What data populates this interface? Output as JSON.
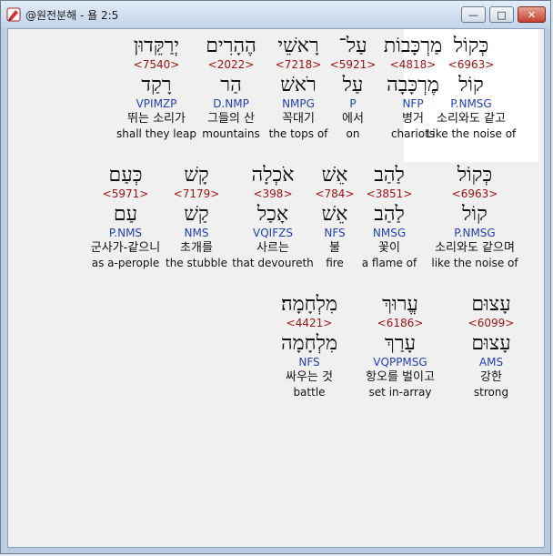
{
  "window": {
    "title": "@원전분해 - 욜 2:5",
    "controls": {
      "minimize": "—",
      "maximize": "□",
      "close": "✕"
    },
    "icon": "app-icon"
  },
  "rows": [
    {
      "words": [
        {
          "hebrew": "כְּקוֹל",
          "strongs": "<6963>",
          "lemma": "קוֹל",
          "morph": "P.NMSG",
          "korean": "소리와도 같고",
          "english": "Like the noise of",
          "selected": true
        },
        {
          "hebrew": "מַרְכָּבוֹת",
          "strongs": "<4818>",
          "lemma": "מֶרְכָּבָה",
          "morph": "NFP",
          "korean": "병거",
          "english": "chariots",
          "selected": false
        },
        {
          "hebrew": "עַל־",
          "strongs": "<5921>",
          "lemma": "עַל",
          "morph": "P",
          "korean": "에서",
          "english": "on",
          "selected": false
        },
        {
          "hebrew": "רָאשֵׁי",
          "strongs": "<7218>",
          "lemma": "רֹאשׁ",
          "morph": "NMPG",
          "korean": "꼭대기",
          "english": "the tops of",
          "selected": false
        },
        {
          "hebrew": "הֶהָרִים",
          "strongs": "<2022>",
          "lemma": "הַר",
          "morph": "D.NMP",
          "korean": "그들의 산",
          "english": "mountains",
          "selected": false
        },
        {
          "hebrew": "יְרַקֵּדוּן",
          "strongs": "<7540>",
          "lemma": "רָקַד",
          "morph": "VPIMZP",
          "korean": "뛰는 소리가",
          "english": "shall they leap",
          "selected": false
        }
      ]
    },
    {
      "words": [
        {
          "hebrew": "כְּקוֹל",
          "strongs": "<6963>",
          "lemma": "קוֹל",
          "morph": "P.NMSG",
          "korean": "소리와도 같으며",
          "english": "like the noise of",
          "selected": false
        },
        {
          "hebrew": "לַהַב",
          "strongs": "<3851>",
          "lemma": "לַהַב",
          "morph": "NMSG",
          "korean": "꽃이",
          "english": "a flame of",
          "selected": false
        },
        {
          "hebrew": "אֵשׁ",
          "strongs": "<784>",
          "lemma": "אֵשׁ",
          "morph": "NFS",
          "korean": "불",
          "english": "fire",
          "selected": false
        },
        {
          "hebrew": "אֹכְלָה",
          "strongs": "<398>",
          "lemma": "אָכַל",
          "morph": "VQIFZS",
          "korean": "사르는",
          "english": "that devoureth",
          "selected": false
        },
        {
          "hebrew": "קָשׁ",
          "strongs": "<7179>",
          "lemma": "קַשׁ",
          "morph": "NMS",
          "korean": "초개를",
          "english": "the stubble",
          "selected": false
        },
        {
          "hebrew": "כְּעַם",
          "strongs": "<5971>",
          "lemma": "עַם",
          "morph": "P.NMS",
          "korean": "군사가-같으니",
          "english": "as a-perople",
          "selected": false
        }
      ]
    },
    {
      "words": [
        {
          "hebrew": "עָצוּם",
          "strongs": "<6099>",
          "lemma": "עָצוּם",
          "morph": "AMS",
          "korean": "강한",
          "english": "strong",
          "selected": false
        },
        {
          "hebrew": "עֱרוּךְ",
          "strongs": "<6186>",
          "lemma": "עָרַךְ",
          "morph": "VQPPMSG",
          "korean": "항오를 벌이고",
          "english": "set in-array",
          "selected": false
        },
        {
          "hebrew": "מִלְחָמָה׃",
          "strongs": "<4421>",
          "lemma": "מִלְחָמָה",
          "morph": "NFS",
          "korean": "싸우는 것",
          "english": "battle",
          "selected": false
        }
      ]
    }
  ],
  "colors": {
    "strongs": "#a01414",
    "morph": "#2340b6",
    "text": "#111111",
    "selected_bg": "#ffffff",
    "content_bg": "#f0f0f0"
  }
}
